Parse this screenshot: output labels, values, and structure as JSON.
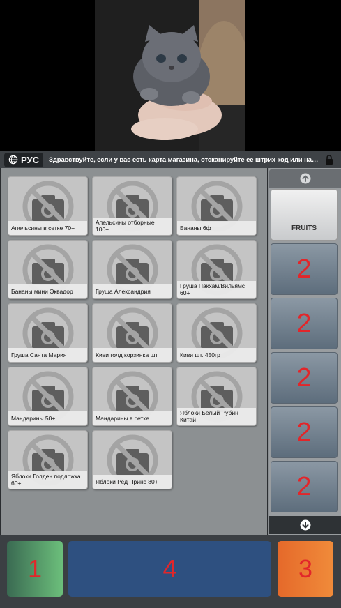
{
  "info_bar": {
    "language": "РУС",
    "message": "Здравствуйте, если у вас есть карта магазина, отсканируйте ее штрих код или нажмите кнопку «К..."
  },
  "products": [
    {
      "label": "Апельсины в сетке 70+"
    },
    {
      "label": "Апельсины отборные 100+"
    },
    {
      "label": "Бананы 6ф"
    },
    {
      "label": "Бананы мини Эквадор"
    },
    {
      "label": "Груша Александрия"
    },
    {
      "label": "Груша Пакхам/Вильямс 60+"
    },
    {
      "label": "Груша Санта Мария"
    },
    {
      "label": "Киви голд корзинка шт."
    },
    {
      "label": "Киви шт. 450гр"
    },
    {
      "label": "Мандарины 50+"
    },
    {
      "label": "Мандарины в сетке"
    },
    {
      "label": "Яблоки Белый Рубин Китай"
    },
    {
      "label": "Яблоки Голден подложка 60+"
    },
    {
      "label": "Яблоки Ред Принс 80+"
    }
  ],
  "categories": [
    {
      "label": "FRUITS",
      "active": true
    },
    {
      "label": "2"
    },
    {
      "label": "2"
    },
    {
      "label": "2"
    },
    {
      "label": "2"
    },
    {
      "label": "2"
    }
  ],
  "bottom_buttons": {
    "left": "1",
    "center": "4",
    "right": "3"
  },
  "colors": {
    "accent_red": "#e2262a",
    "center_button": "#2e5080",
    "left_button": "#6cbf7b",
    "right_button": "#f08b3a"
  },
  "icons": {
    "language": "globe-icon",
    "lock": "lock-icon",
    "product_placeholder": "no-photo-icon",
    "scroll_up": "arrow-up-circle-icon",
    "scroll_down": "arrow-down-circle-icon"
  }
}
